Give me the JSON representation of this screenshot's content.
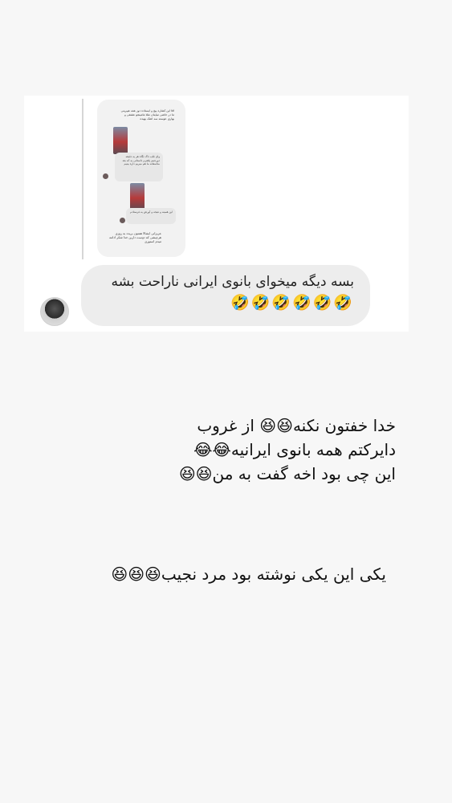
{
  "inner_story": {
    "header_text": "اقا این کشاره پیچ و ایستاده دوز همه هیپرینی ما در حاشی میاینان مثلا مامینجو عشقی و بهاری عوسته سه اشک بهیده",
    "comment_1_text": "وای قلب تاک نگاه هر یه دقیقه دوره‌نیم پلتفرم داستانی یه که بعد متاسفانه ما هم میریم داره بینیم",
    "comment_2_text": "این همینه و نتیجه و آورش یه فرستادم",
    "footer_text": "عزیزانی ایشالا همتون بریده به روزی هرچیشی که دوست دارین خدا شکر ادامه میدم استوری"
  },
  "reply": {
    "text": "بسه دیگه میخوای بانوی ایرانی ناراحت بشه",
    "emojis": "🤣🤣🤣🤣🤣🤣"
  },
  "caption_1": {
    "line_1": "خدا خفتون نکنه😆😆 از غروب",
    "line_2": "دایرکتم همه بانوی ایرانیه😂😂",
    "line_3": "این چی بود اخه گفت به من😆😆"
  },
  "caption_2": {
    "text": "یکی این یکی نوشته بود مرد نجیب😆😆😆"
  },
  "colors": {
    "background": "#f7f7f7",
    "card": "#ffffff",
    "bubble": "#ededed",
    "text": "#111111"
  }
}
